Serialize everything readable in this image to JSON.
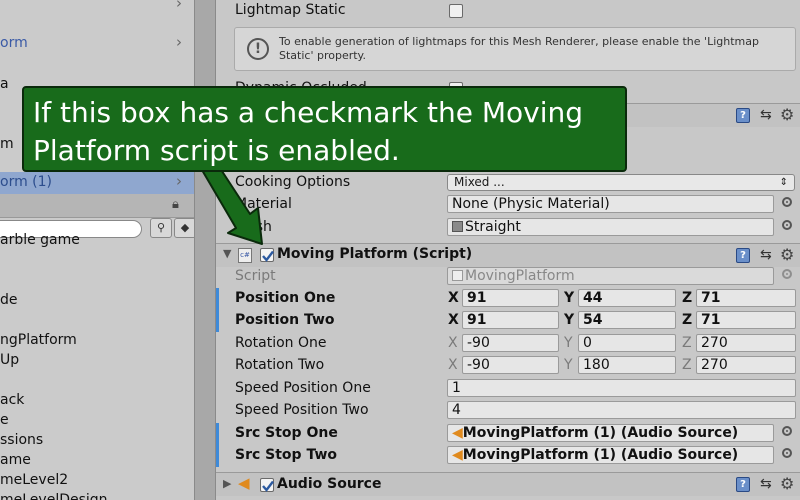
{
  "hierarchy": {
    "rows": [
      {
        "text": "orm"
      },
      {
        "text": "a"
      },
      {
        "text": "m"
      },
      {
        "text": "orm (1)"
      }
    ],
    "list": [
      {
        "text": "arble game"
      },
      {
        "text": "de"
      },
      {
        "text": "ngPlatform"
      },
      {
        "text": "Up"
      },
      {
        "text": "ack"
      },
      {
        "text": "e"
      },
      {
        "text": "ssions"
      },
      {
        "text": "ame"
      },
      {
        "text": "meLevel2"
      },
      {
        "text": "meLevelDesign"
      }
    ]
  },
  "inspector": {
    "lightmap_static": "Lightmap Static",
    "info_text": "To enable generation of lightmaps for this Mesh Renderer, please enable the 'Lightmap Static' property.",
    "dynamic_occluded": "Dynamic Occluded",
    "cooking_options_label": "Cooking Options",
    "cooking_options_value": "Mixed ...",
    "material_label": "Material",
    "material_value": "None (Physic Material)",
    "mesh_label": "Mesh",
    "mesh_value": "Straight",
    "component_title": "Moving Platform (Script)",
    "script_label": "Script",
    "script_value": "MovingPlatform",
    "position_one_label": "Position One",
    "position_one": {
      "x": "91",
      "y": "44",
      "z": "71"
    },
    "position_two_label": "Position Two",
    "position_two": {
      "x": "91",
      "y": "54",
      "z": "71"
    },
    "rotation_one_label": "Rotation One",
    "rotation_one": {
      "x": "-90",
      "y": "0",
      "z": "270"
    },
    "rotation_two_label": "Rotation Two",
    "rotation_two": {
      "x": "-90",
      "y": "180",
      "z": "270"
    },
    "speed_one_label": "Speed Position One",
    "speed_one": "1",
    "speed_two_label": "Speed Position Two",
    "speed_two": "4",
    "src_stop_one_label": "Src Stop One",
    "src_stop_one": "MovingPlatform (1) (Audio Source)",
    "src_stop_two_label": "Src Stop Two",
    "src_stop_two": "MovingPlatform (1) (Audio Source)",
    "audio_source_title": "Audio Source",
    "axis_x": "X",
    "axis_y": "Y",
    "axis_z": "Z"
  },
  "callout": {
    "text": "If this box has a checkmark the Moving Platform script is enabled."
  },
  "colors": {
    "callout_bg": "#186b1b",
    "modified_bar": "#3f8ad8",
    "selection": "#8fa7cf"
  }
}
